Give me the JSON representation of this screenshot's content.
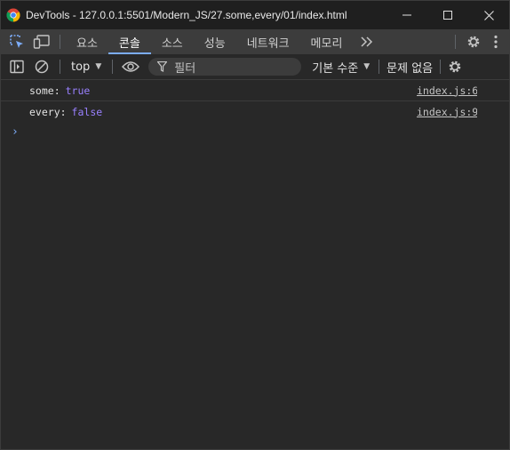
{
  "window": {
    "title": "DevTools - 127.0.0.1:5501/Modern_JS/27.some,every/01/index.html"
  },
  "tabs": [
    {
      "label": "요소",
      "active": false
    },
    {
      "label": "콘솔",
      "active": true
    },
    {
      "label": "소스",
      "active": false
    },
    {
      "label": "성능",
      "active": false
    },
    {
      "label": "네트워크",
      "active": false
    },
    {
      "label": "메모리",
      "active": false
    }
  ],
  "toolbar": {
    "context": "top",
    "filter_placeholder": "필터",
    "level": "기본 수준",
    "issues": "문제 없음"
  },
  "console": {
    "messages": [
      {
        "key": "some:",
        "value": "true",
        "source": "index.js:6"
      },
      {
        "key": "every:",
        "value": "false",
        "source": "index.js:9"
      }
    ],
    "prompt": "›"
  },
  "colors": {
    "accent": "#7cacf8",
    "boolean": "#9980ff",
    "background": "#282828",
    "tabbar": "#3c3c3c"
  }
}
